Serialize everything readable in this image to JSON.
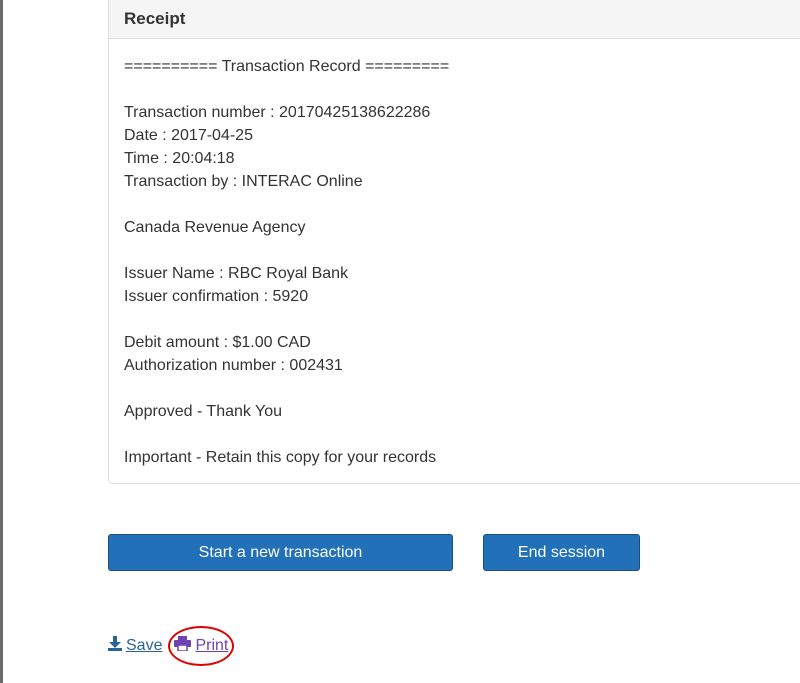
{
  "panel": {
    "title": "Receipt",
    "lines": [
      "========== Transaction Record =========",
      "",
      "Transaction number : 20170425138622286",
      "Date : 2017-04-25",
      "Time : 20:04:18",
      "Transaction by : INTERAC Online",
      "",
      "Canada Revenue Agency",
      "",
      "Issuer Name : RBC Royal Bank",
      "Issuer confirmation : 5920",
      "",
      "Debit amount : $1.00 CAD",
      "Authorization number : 002431",
      "",
      "Approved - Thank You",
      "",
      "Important - Retain this copy for your records"
    ]
  },
  "buttons": {
    "new_transaction": "Start a new transaction",
    "end_session": "End session"
  },
  "actions": {
    "save_label": "Save",
    "save_icon": "download-icon",
    "print_label": "Print",
    "print_icon": "printer-icon"
  },
  "colors": {
    "button": "#2270b8",
    "annotation": "#e00000",
    "print_link": "#6f42b0",
    "save_link": "#2a6496"
  }
}
